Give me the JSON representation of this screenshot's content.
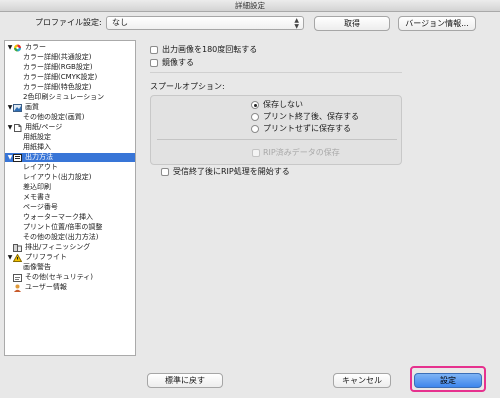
{
  "window": {
    "title": "詳細設定"
  },
  "toolbar": {
    "profile_label": "プロファイル設定:",
    "profile_value": "なし",
    "acquire_button": "取得",
    "version_button": "バージョン情報..."
  },
  "sidebar": {
    "items": [
      {
        "label": "カラー",
        "level": 0,
        "expanded": true,
        "icon": "color-wheel-icon",
        "selected": false
      },
      {
        "label": "カラー詳細(共通設定)",
        "level": 1,
        "selected": false
      },
      {
        "label": "カラー詳細(RGB設定)",
        "level": 1,
        "selected": false
      },
      {
        "label": "カラー詳細(CMYK設定)",
        "level": 1,
        "selected": false
      },
      {
        "label": "カラー詳細(特色設定)",
        "level": 1,
        "selected": false
      },
      {
        "label": "2色印刷シミュレーション",
        "level": 1,
        "selected": false
      },
      {
        "label": "画質",
        "level": 0,
        "expanded": true,
        "icon": "image-quality-icon",
        "selected": false
      },
      {
        "label": "その他の設定(画質)",
        "level": 1,
        "selected": false
      },
      {
        "label": "用紙/ページ",
        "level": 0,
        "expanded": true,
        "icon": "paper-icon",
        "selected": false
      },
      {
        "label": "用紙設定",
        "level": 1,
        "selected": false
      },
      {
        "label": "用紙挿入",
        "level": 1,
        "selected": false
      },
      {
        "label": "出力方法",
        "level": 0,
        "expanded": true,
        "icon": "output-icon",
        "selected": true
      },
      {
        "label": "レイアウト",
        "level": 1,
        "selected": false
      },
      {
        "label": "レイアウト(出力設定)",
        "level": 1,
        "selected": false
      },
      {
        "label": "差込印刷",
        "level": 1,
        "selected": false
      },
      {
        "label": "メモ書き",
        "level": 1,
        "selected": false
      },
      {
        "label": "ページ番号",
        "level": 1,
        "selected": false
      },
      {
        "label": "ウォーターマーク挿入",
        "level": 1,
        "selected": false
      },
      {
        "label": "プリント位置/倍率の調整",
        "level": 1,
        "selected": false
      },
      {
        "label": "その他の設定(出力方法)",
        "level": 1,
        "selected": false
      },
      {
        "label": "排出/フィニッシング",
        "level": 0,
        "expanded": false,
        "icon": "finisher-icon",
        "selected": false
      },
      {
        "label": "プリフライト",
        "level": 0,
        "expanded": true,
        "icon": "preflight-icon",
        "selected": false
      },
      {
        "label": "画像警告",
        "level": 1,
        "selected": false
      },
      {
        "label": "その他(セキュリティ)",
        "level": 0,
        "expanded": false,
        "icon": "security-icon",
        "selected": false
      },
      {
        "label": "ユーザー情報",
        "level": 0,
        "expanded": false,
        "icon": "user-icon",
        "selected": false
      }
    ]
  },
  "main": {
    "rotate_label": "出力画像を180度回転する",
    "mirror_label": "鏡像する",
    "spool_heading": "スプールオプション:",
    "spool_options": [
      {
        "label": "保存しない",
        "selected": true
      },
      {
        "label": "プリント終了後、保存する",
        "selected": false
      },
      {
        "label": "プリントせずに保存する",
        "selected": false
      }
    ],
    "rip_save_label": "RIP済みデータの保存",
    "rip_after_receive_label": "受信終了後にRIP処理を開始する"
  },
  "buttons": {
    "default_label": "標準に戻す",
    "cancel_label": "キャンセル",
    "ok_label": "設定"
  },
  "colors": {
    "selection": "#3875d7",
    "highlight": "#e6318e",
    "default_button": "#3f86ec"
  }
}
